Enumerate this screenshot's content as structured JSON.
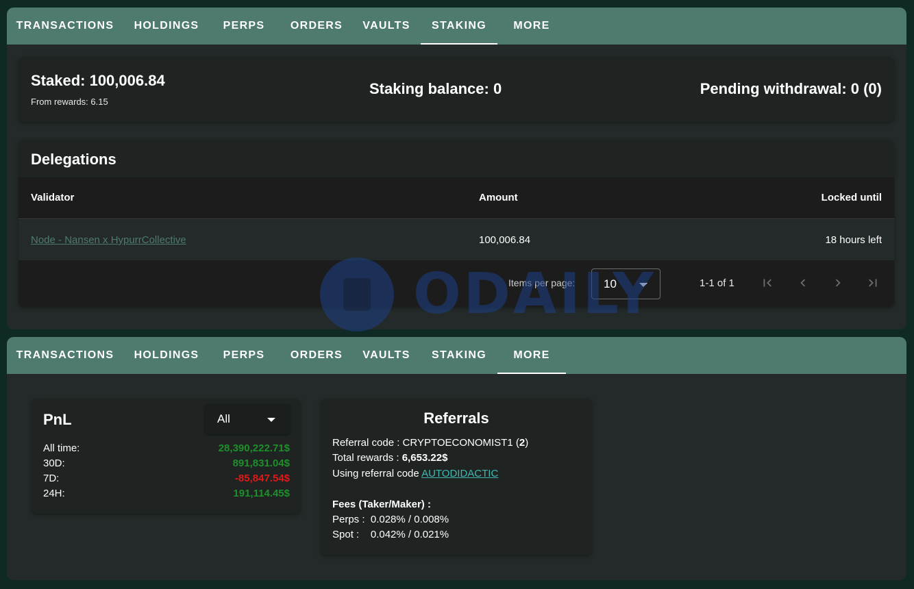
{
  "tabs": [
    "TRANSACTIONS",
    "HOLDINGS",
    "PERPS",
    "ORDERS",
    "VAULTS",
    "STAKING",
    "MORE"
  ],
  "staking": {
    "staked": "Staked: 100,006.84",
    "from_rewards": "From rewards: 6.15",
    "balance": "Staking balance: 0",
    "pending": "Pending withdrawal: 0 (0)"
  },
  "delegations": {
    "title": "Delegations",
    "columns": [
      "Validator",
      "Amount",
      "Locked until"
    ],
    "rows": [
      {
        "validator": "Node - Nansen x HypurrCollective",
        "amount": "100,006.84",
        "locked_until": "18 hours left"
      }
    ],
    "items_per_page_label": "Items per page:",
    "items_per_page_value": "10",
    "range": "1-1 of 1"
  },
  "watermark": "ODAILY",
  "pnl": {
    "title": "PnL",
    "filter": "All",
    "rows": [
      {
        "label": "All time:",
        "value": "28,390,222.71$",
        "sign": "positive"
      },
      {
        "label": "30D:",
        "value": "891,831.04$",
        "sign": "positive"
      },
      {
        "label": "7D:",
        "value": "-85,847.54$",
        "sign": "negative"
      },
      {
        "label": "24H:",
        "value": "191,114.45$",
        "sign": "positive"
      }
    ]
  },
  "referrals": {
    "title": "Referrals",
    "code_label": "Referral code : CRYPTOECONOMIST1 (",
    "code_count": "2",
    "code_close": ")",
    "total_label": "Total rewards : ",
    "total_value": "6,653.22$",
    "using_label": "Using referral code ",
    "using_code": "AUTODIDACTIC",
    "fees_title": "Fees (Taker/Maker) :",
    "perps_fees": "Perps :  0.028% / 0.008%",
    "spot_fees": "Spot :    0.042% / 0.021%"
  },
  "colors": {
    "tab_bar": "#4f7a70",
    "panel": "#242a29",
    "positive": "#1f8f2a",
    "negative": "#e01818",
    "link": "#3fb9b0"
  },
  "icons": {
    "first_page": "first-page-icon",
    "prev_page": "prev-page-icon",
    "next_page": "next-page-icon",
    "last_page": "last-page-icon",
    "dropdown": "chevron-down-icon"
  }
}
